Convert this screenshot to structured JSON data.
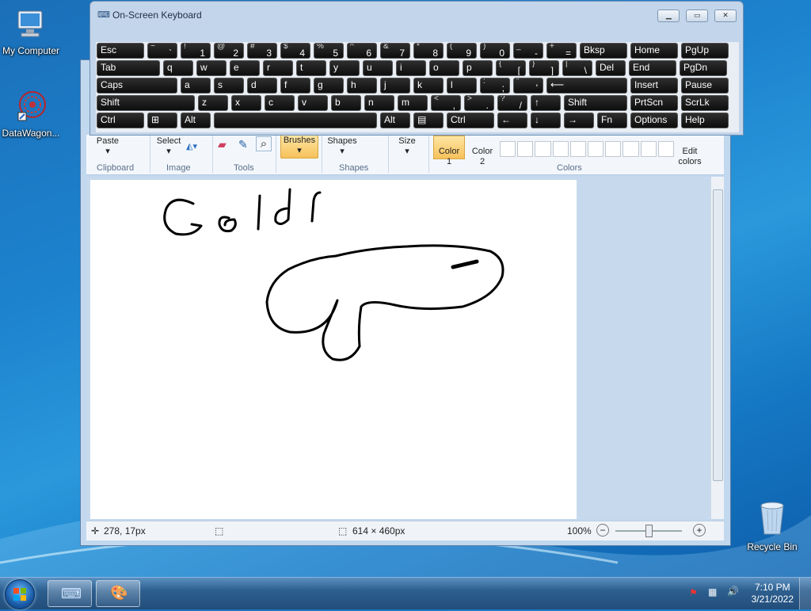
{
  "desktop": {
    "icons": [
      {
        "label": "My Computer",
        "icon": "computer-icon"
      },
      {
        "label": "DataWagon...",
        "icon": "datawagon-icon"
      },
      {
        "label": "Recycle Bin",
        "icon": "recycle-bin-icon"
      }
    ]
  },
  "osk": {
    "title": "On-Screen Keyboard",
    "rows": [
      [
        {
          "p": "Esc"
        },
        {
          "s": "~",
          "m": "`"
        },
        {
          "s": "!",
          "m": "1"
        },
        {
          "s": "@",
          "m": "2"
        },
        {
          "s": "#",
          "m": "3"
        },
        {
          "s": "$",
          "m": "4"
        },
        {
          "s": "%",
          "m": "5"
        },
        {
          "s": "^",
          "m": "6"
        },
        {
          "s": "&",
          "m": "7"
        },
        {
          "s": "*",
          "m": "8"
        },
        {
          "s": "(",
          "m": "9"
        },
        {
          "s": ")",
          "m": "0"
        },
        {
          "s": "_",
          "m": "-"
        },
        {
          "s": "+",
          "m": "="
        },
        {
          "p": "Bksp"
        },
        {
          "p": "Home"
        },
        {
          "p": "PgUp"
        }
      ],
      [
        {
          "p": "Tab"
        },
        {
          "p": "q"
        },
        {
          "p": "w"
        },
        {
          "p": "e"
        },
        {
          "p": "r"
        },
        {
          "p": "t"
        },
        {
          "p": "y"
        },
        {
          "p": "u"
        },
        {
          "p": "i"
        },
        {
          "p": "o"
        },
        {
          "p": "p"
        },
        {
          "s": "{",
          "m": "["
        },
        {
          "s": "}",
          "m": "]"
        },
        {
          "s": "|",
          "m": "\\"
        },
        {
          "p": "Del"
        },
        {
          "p": "End"
        },
        {
          "p": "PgDn"
        }
      ],
      [
        {
          "p": "Caps"
        },
        {
          "p": "a"
        },
        {
          "p": "s"
        },
        {
          "p": "d"
        },
        {
          "p": "f"
        },
        {
          "p": "g"
        },
        {
          "p": "h"
        },
        {
          "p": "j"
        },
        {
          "p": "k"
        },
        {
          "p": "l"
        },
        {
          "s": ":",
          "m": ";"
        },
        {
          "s": "\"",
          "m": "'"
        },
        {
          "p": "⟵"
        },
        {
          "p": "Insert"
        },
        {
          "p": "Pause"
        }
      ],
      [
        {
          "p": "Shift"
        },
        {
          "p": "z"
        },
        {
          "p": "x"
        },
        {
          "p": "c"
        },
        {
          "p": "v"
        },
        {
          "p": "b"
        },
        {
          "p": "n"
        },
        {
          "p": "m"
        },
        {
          "s": "<",
          "m": ","
        },
        {
          "s": ">",
          "m": "."
        },
        {
          "s": "?",
          "m": "/"
        },
        {
          "p": "↑"
        },
        {
          "p": "Shift"
        },
        {
          "p": "PrtScn"
        },
        {
          "p": "ScrLk"
        }
      ],
      [
        {
          "p": "Ctrl"
        },
        {
          "p": "⊞"
        },
        {
          "p": "Alt"
        },
        {
          "p": ""
        },
        {
          "p": "Alt"
        },
        {
          "p": "▤"
        },
        {
          "p": "Ctrl"
        },
        {
          "p": "←"
        },
        {
          "p": "↓"
        },
        {
          "p": "→"
        },
        {
          "p": "Fn"
        },
        {
          "p": "Options"
        },
        {
          "p": "Help"
        }
      ]
    ]
  },
  "paint": {
    "ribbon": {
      "paste": "Paste",
      "select": "Select",
      "brushes": "Brushes",
      "shapes": "Shapes",
      "size": "Size",
      "color1": "Color\n1",
      "color2": "Color\n2",
      "edit_colors": "Edit\ncolors",
      "groups": [
        "Clipboard",
        "Image",
        "Tools",
        "Shapes",
        "Colors"
      ]
    },
    "canvas_text": "Goldf",
    "status": {
      "cursor": "278, 17px",
      "size": "614 × 460px",
      "zoom": "100%"
    }
  },
  "taskbar": {
    "time": "7:10 PM",
    "date": "3/21/2022"
  }
}
